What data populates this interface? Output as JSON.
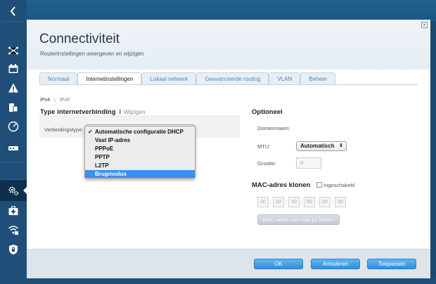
{
  "sidebar": {
    "back_icon": "chevron-left-icon",
    "items": [
      {
        "icon": "network-map-icon"
      },
      {
        "icon": "calendar-icon"
      },
      {
        "icon": "warning-triangle-icon"
      },
      {
        "icon": "devices-icon"
      },
      {
        "icon": "speed-gauge-icon"
      },
      {
        "icon": "router-icon"
      },
      {
        "icon": "gear-icon",
        "active": true
      },
      {
        "icon": "first-aid-icon"
      },
      {
        "icon": "wifi-icon"
      },
      {
        "icon": "shield-lock-icon"
      }
    ]
  },
  "dialog": {
    "title": "Connectiviteit",
    "subtitle": "Routerinstellingen weergeven en wijzigen",
    "close": "×"
  },
  "tabs": [
    "Normaal",
    "Internetinstellingen",
    "Lokaal netwerk",
    "Geavanceerde routing",
    "VLAN",
    "Beheer"
  ],
  "active_tab": "Internetinstellingen",
  "ip_switch": {
    "ipv4": "IPv4",
    "separator": "|",
    "ipv6": "IPv6"
  },
  "connection": {
    "section_title": "Type internetverbinding",
    "pipe": "I",
    "change_link": "Wijzigen",
    "type_label": "Verbindingstype:",
    "options": [
      "Automatische configuratie DHCP",
      "Vast IP-adres",
      "PPPoE",
      "PPTP",
      "L2TP",
      "Brugmodus"
    ],
    "checked_option": "Automatische configuratie DHCP",
    "highlighted_option": "Brugmodus"
  },
  "optional": {
    "section_title": "Optioneel",
    "domain_label": "Domeinnaam:",
    "mtu_label": "MTU:",
    "mtu_value": "Automatisch",
    "mtu_arrow": "⇕",
    "size_label": "Grootte:",
    "size_value": "0"
  },
  "mac_clone": {
    "section_title": "MAC-adres klonen",
    "enabled_label": "Ingeschakeld",
    "cells": [
      "00",
      "00",
      "00",
      "00",
      "00",
      "00"
    ],
    "separator": ":",
    "clone_button": "MAC-adres van mijn pc klonen"
  },
  "footer": {
    "ok": "OK",
    "cancel": "Annuleren",
    "apply": "Toepassen"
  },
  "colors": {
    "accent": "#3e8bcf",
    "button_blue": "#2f8fd8",
    "selection": "#3b8ef2",
    "sidebar": "#1f4f78"
  }
}
